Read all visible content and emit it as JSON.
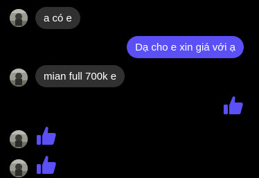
{
  "colors": {
    "background": "#000000",
    "incoming_bubble": "#303030",
    "outgoing_bubble": "#5b50f5",
    "like_icon": "#5b50f5",
    "text": "#ffffff"
  },
  "messages": [
    {
      "direction": "incoming",
      "type": "text",
      "text": "a có e"
    },
    {
      "direction": "outgoing",
      "type": "text",
      "text": "Dạ cho e xin giá với ạ"
    },
    {
      "direction": "incoming",
      "type": "text",
      "text": "mian full 700k e"
    },
    {
      "direction": "outgoing",
      "type": "like",
      "icon": "thumbs-up-icon"
    },
    {
      "direction": "incoming",
      "type": "like",
      "icon": "thumbs-up-icon"
    },
    {
      "direction": "incoming",
      "type": "like",
      "icon": "thumbs-up-icon"
    }
  ]
}
